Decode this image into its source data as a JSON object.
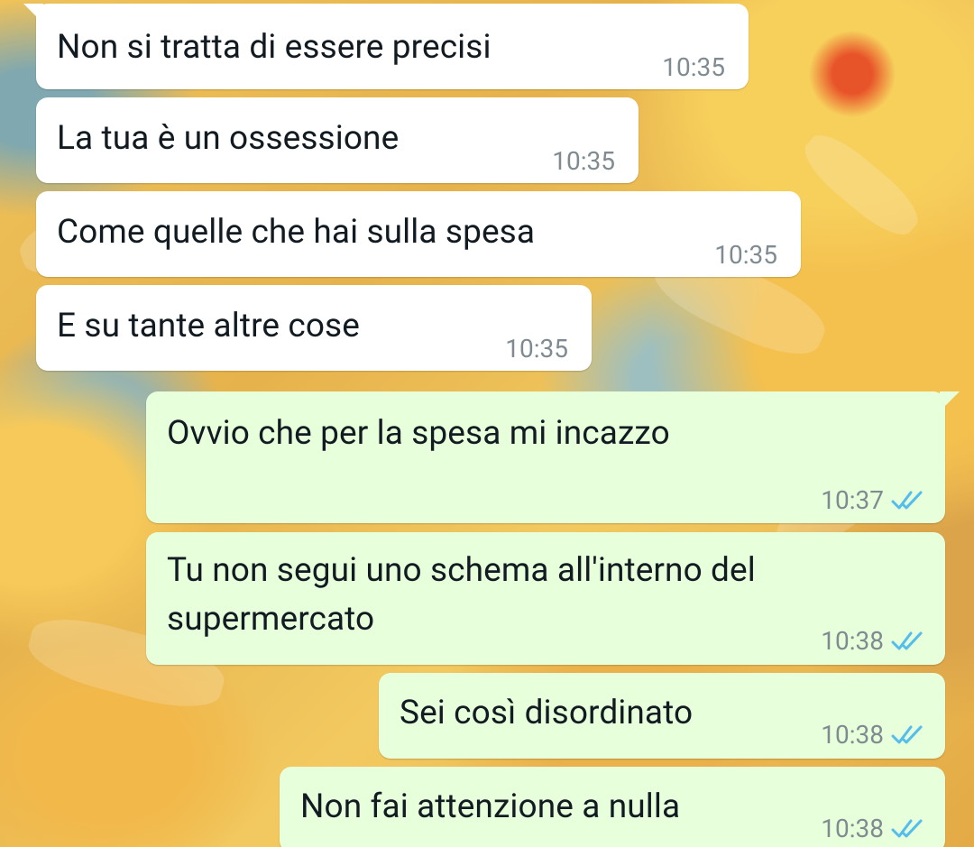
{
  "chat": {
    "messages": [
      {
        "direction": "incoming",
        "text": "Non si tratta di essere precisi",
        "time": "10:35"
      },
      {
        "direction": "incoming",
        "text": "La tua è un ossessione",
        "time": "10:35"
      },
      {
        "direction": "incoming",
        "text": "Come quelle che hai sulla spesa",
        "time": "10:35"
      },
      {
        "direction": "incoming",
        "text": "E su tante altre cose",
        "time": "10:35"
      },
      {
        "direction": "outgoing",
        "text": "Ovvio che per la spesa mi incazzo",
        "time": "10:37",
        "status": "read"
      },
      {
        "direction": "outgoing",
        "text_line1": "Tu non segui uno schema all'interno del",
        "text_line2": "supermercato",
        "time": "10:38",
        "status": "read"
      },
      {
        "direction": "outgoing",
        "text": "Sei così disordinato",
        "time": "10:38",
        "status": "read"
      },
      {
        "direction": "outgoing",
        "text": "Non fai attenzione a nulla",
        "time": "10:38",
        "status": "read"
      }
    ]
  },
  "colors": {
    "incoming_bubble": "#ffffff",
    "outgoing_bubble": "#e7ffdb",
    "text": "#111b21",
    "timestamp": "#7f8b91",
    "read_ticks": "#53bdeb"
  },
  "icons": {
    "read_receipt": "double-check-icon"
  }
}
